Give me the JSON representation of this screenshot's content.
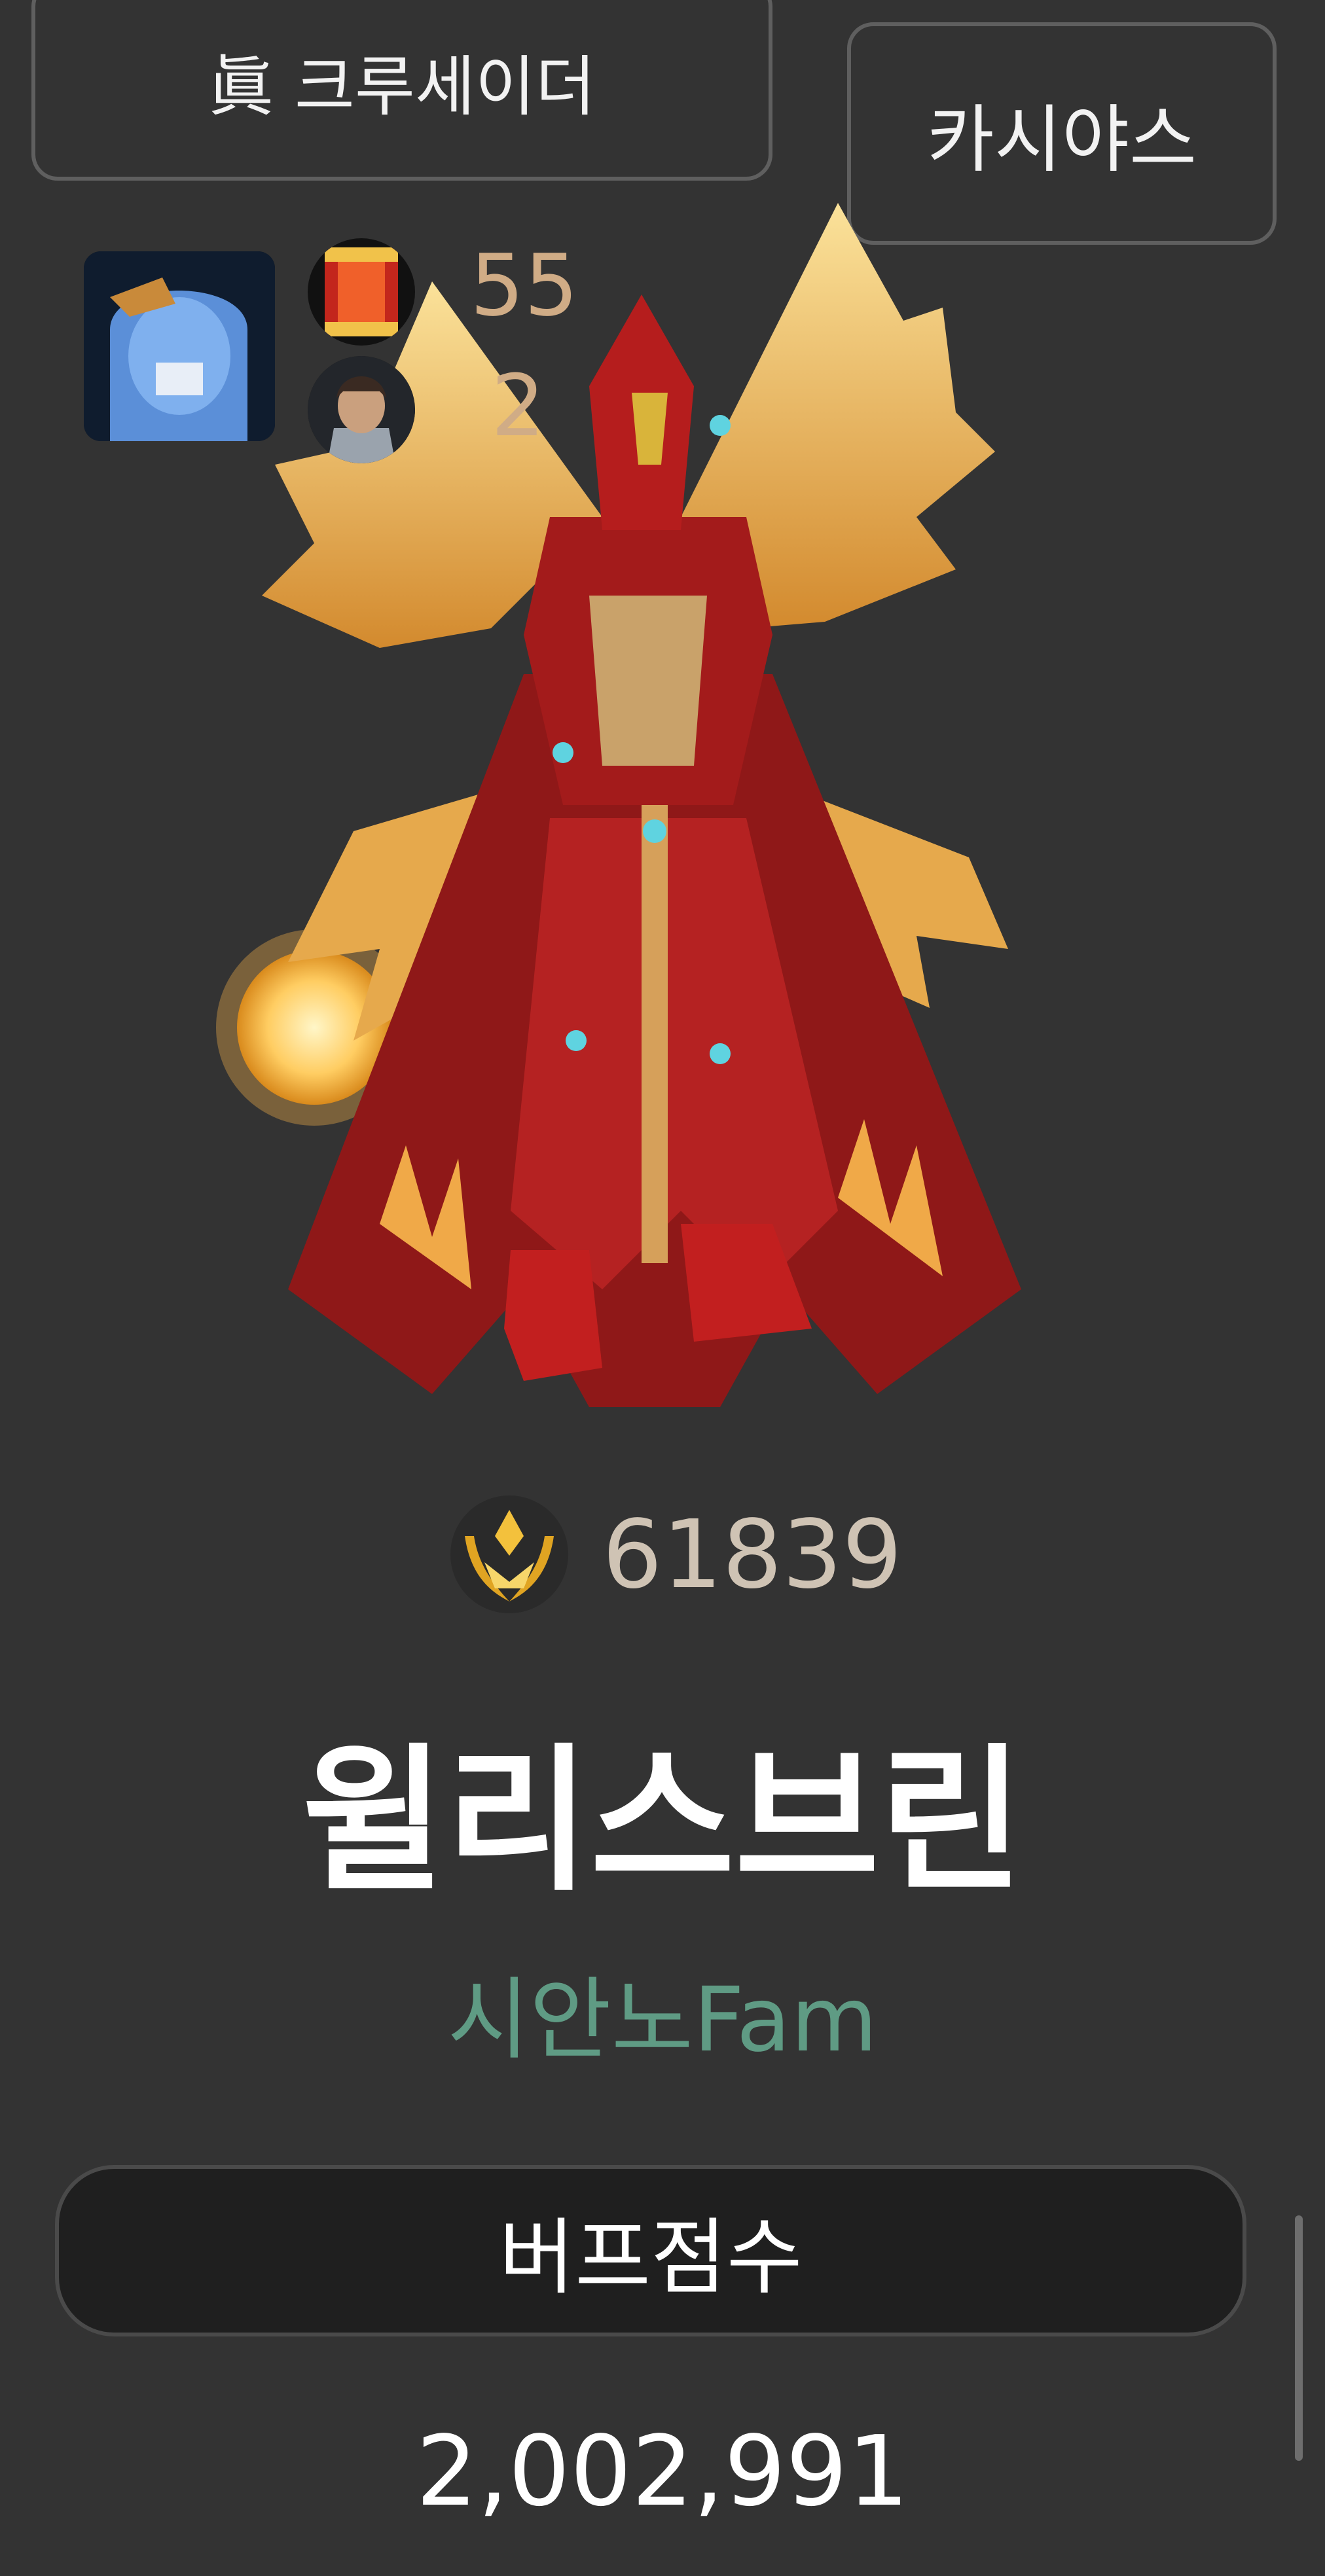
{
  "header": {
    "job_label": "眞 크루세이더",
    "server_label": "카시야스"
  },
  "stats": {
    "medal_count": "55",
    "character_count": "2"
  },
  "profile": {
    "fame_value": "61839",
    "character_name": "윌리스브린",
    "guild_name": "시안노Fam"
  },
  "buff_score": {
    "button_label": "버프점수",
    "value": "2,002,991"
  },
  "colors": {
    "background": "#333333",
    "stat_number": "#d0ac86",
    "fame_value": "#cfc3b4",
    "guild_name": "#5f9b84",
    "button_fill": "#1f1f1f"
  },
  "icons": {
    "adventurer_avatar": "adventurer-avatar-icon",
    "medal": "medal-icon",
    "character_thumb": "character-thumb-icon",
    "fame": "fame-laurel-icon"
  }
}
